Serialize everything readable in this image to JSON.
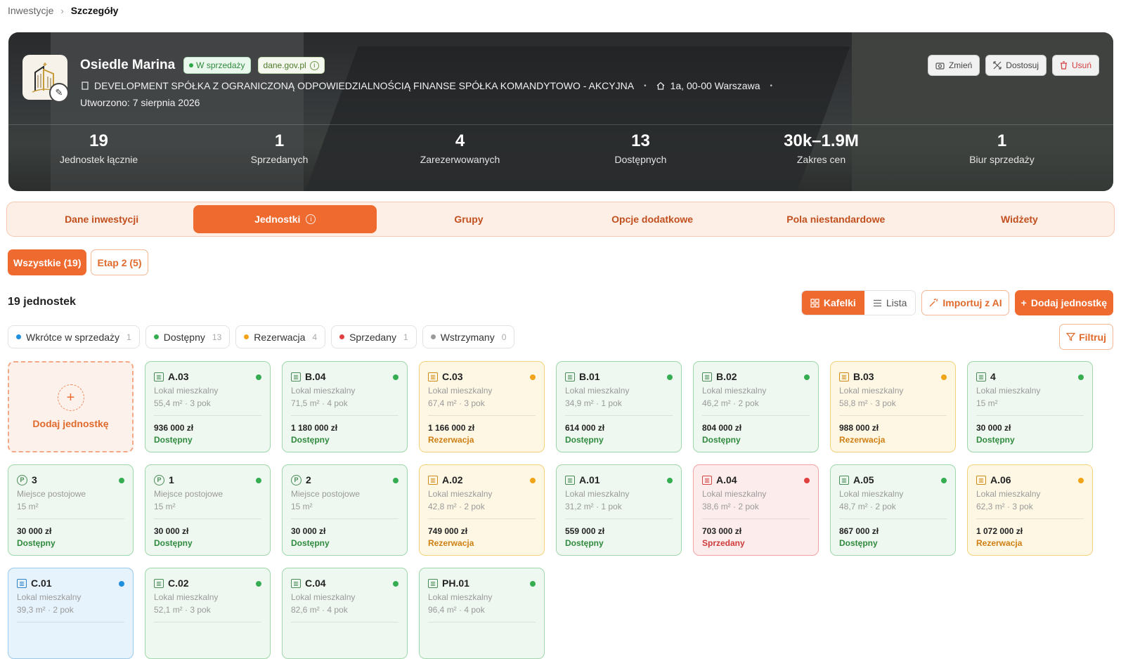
{
  "breadcrumb": {
    "root": "Inwestycje",
    "separator": "›",
    "current": "Szczegóły"
  },
  "hero": {
    "name": "Osiedle Marina",
    "status_badge": "W sprzedaży",
    "source_badge": "dane.gov.pl",
    "company": "DEVELOPMENT SPÓŁKA Z OGRANICZONĄ ODPOWIEDZIALNOŚCIĄ FINANSE SPÓŁKA KOMANDYTOWO - AKCYJNA",
    "address": "1a, 00-00 Warszawa",
    "created": "Utworzono: 7 sierpnia 2026",
    "buttons": {
      "change": "Zmień",
      "customize": "Dostosuj",
      "delete": "Usuń"
    },
    "stats": [
      {
        "value": "19",
        "label": "Jednostek łącznie"
      },
      {
        "value": "1",
        "label": "Sprzedanych"
      },
      {
        "value": "4",
        "label": "Zarezerwowanych"
      },
      {
        "value": "13",
        "label": "Dostępnych"
      },
      {
        "value": "30k–1.9M",
        "label": "Zakres cen"
      },
      {
        "value": "1",
        "label": "Biur sprzedaży"
      }
    ]
  },
  "tabs": [
    {
      "label": "Dane inwestycji"
    },
    {
      "label": "Jednostki",
      "active": true
    },
    {
      "label": "Grupy"
    },
    {
      "label": "Opcje dodatkowe"
    },
    {
      "label": "Pola niestandardowe"
    },
    {
      "label": "Widżety"
    }
  ],
  "phases": {
    "all": "Wszystkie (19)",
    "stage2": "Etap 2 (5)"
  },
  "units_count": "19 jednostek",
  "actions": {
    "tiles": "Kafelki",
    "list": "Lista",
    "import_ai": "Importuj z AI",
    "add_unit": "Dodaj jednostkę",
    "filter": "Filtruj"
  },
  "filters": [
    {
      "label": "Wkrótce w sprzedaży",
      "count": "1",
      "color": "#1f8fe0"
    },
    {
      "label": "Dostępny",
      "count": "13",
      "color": "#37ad52"
    },
    {
      "label": "Rezerwacja",
      "count": "4",
      "color": "#f1a419"
    },
    {
      "label": "Sprzedany",
      "count": "1",
      "color": "#e04040"
    },
    {
      "label": "Wstrzymany",
      "count": "0",
      "color": "#9a9a9a"
    }
  ],
  "add_card_label": "Dodaj jednostkę",
  "units": [
    {
      "name": "A.03",
      "type": "Lokal mieszkalny",
      "area": "55,4 m² · 3 pok",
      "price": "936 000 zł",
      "status": "Dostępny",
      "variant": "green",
      "icon": "building"
    },
    {
      "name": "B.04",
      "type": "Lokal mieszkalny",
      "area": "71,5 m² · 4 pok",
      "price": "1 180 000 zł",
      "status": "Dostępny",
      "variant": "green",
      "icon": "building"
    },
    {
      "name": "C.03",
      "type": "Lokal mieszkalny",
      "area": "67,4 m² · 3 pok",
      "price": "1 166 000 zł",
      "status": "Rezerwacja",
      "variant": "yellow",
      "icon": "building"
    },
    {
      "name": "B.01",
      "type": "Lokal mieszkalny",
      "area": "34,9 m² · 1 pok",
      "price": "614 000 zł",
      "status": "Dostępny",
      "variant": "green",
      "icon": "building"
    },
    {
      "name": "B.02",
      "type": "Lokal mieszkalny",
      "area": "46,2 m² · 2 pok",
      "price": "804 000 zł",
      "status": "Dostępny",
      "variant": "green",
      "icon": "building"
    },
    {
      "name": "B.03",
      "type": "Lokal mieszkalny",
      "area": "58,8 m² · 3 pok",
      "price": "988 000 zł",
      "status": "Rezerwacja",
      "variant": "yellow",
      "icon": "building"
    },
    {
      "name": "4",
      "type": "Lokal mieszkalny",
      "area": "15 m²",
      "price": "30 000 zł",
      "status": "Dostępny",
      "variant": "green",
      "icon": "building"
    },
    {
      "name": "3",
      "type": "Miejsce postojowe",
      "area": "15 m²",
      "price": "30 000 zł",
      "status": "Dostępny",
      "variant": "green",
      "icon": "parking"
    },
    {
      "name": "1",
      "type": "Miejsce postojowe",
      "area": "15 m²",
      "price": "30 000 zł",
      "status": "Dostępny",
      "variant": "green",
      "icon": "parking"
    },
    {
      "name": "2",
      "type": "Miejsce postojowe",
      "area": "15 m²",
      "price": "30 000 zł",
      "status": "Dostępny",
      "variant": "green",
      "icon": "parking"
    },
    {
      "name": "A.02",
      "type": "Lokal mieszkalny",
      "area": "42,8 m² · 2 pok",
      "price": "749 000 zł",
      "status": "Rezerwacja",
      "variant": "yellow",
      "icon": "building"
    },
    {
      "name": "A.01",
      "type": "Lokal mieszkalny",
      "area": "31,2 m² · 1 pok",
      "price": "559 000 zł",
      "status": "Dostępny",
      "variant": "green",
      "icon": "building"
    },
    {
      "name": "A.04",
      "type": "Lokal mieszkalny",
      "area": "38,6 m² · 2 pok",
      "price": "703 000 zł",
      "status": "Sprzedany",
      "variant": "red",
      "icon": "building"
    },
    {
      "name": "A.05",
      "type": "Lokal mieszkalny",
      "area": "48,7 m² · 2 pok",
      "price": "867 000 zł",
      "status": "Dostępny",
      "variant": "green",
      "icon": "building"
    },
    {
      "name": "A.06",
      "type": "Lokal mieszkalny",
      "area": "62,3 m² · 3 pok",
      "price": "1 072 000 zł",
      "status": "Rezerwacja",
      "variant": "yellow",
      "icon": "building"
    },
    {
      "name": "C.01",
      "type": "Lokal mieszkalny",
      "area": "39,3 m² · 2 pok",
      "price": "",
      "status": "",
      "variant": "blue",
      "icon": "building"
    },
    {
      "name": "C.02",
      "type": "Lokal mieszkalny",
      "area": "52,1 m² · 3 pok",
      "price": "",
      "status": "",
      "variant": "green",
      "icon": "building"
    },
    {
      "name": "C.04",
      "type": "Lokal mieszkalny",
      "area": "82,6 m² · 4 pok",
      "price": "",
      "status": "",
      "variant": "green",
      "icon": "building"
    },
    {
      "name": "PH.01",
      "type": "Lokal mieszkalny",
      "area": "96,4 m² · 4 pok",
      "price": "",
      "status": "",
      "variant": "green",
      "icon": "building"
    }
  ]
}
